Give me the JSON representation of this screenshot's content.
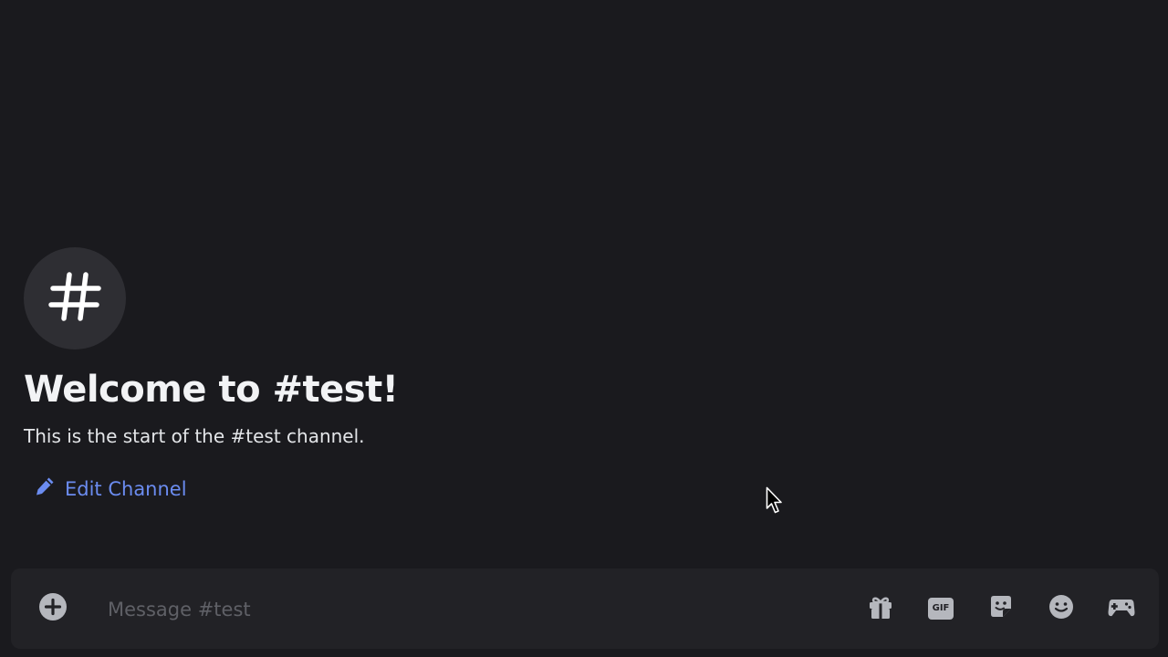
{
  "welcome": {
    "icon": "hash-icon",
    "title": "Welcome to #test!",
    "subtitle": "This is the start of the #test channel.",
    "edit_label": "Edit Channel"
  },
  "composer": {
    "placeholder": "Message #test",
    "value": "",
    "icons": [
      "add-circle-icon",
      "gift-icon",
      "gif-icon",
      "sticker-icon",
      "emoji-icon",
      "activities-icon"
    ],
    "gif_label": "GIF"
  },
  "colors": {
    "background": "#1a1a1e",
    "composer": "#222226",
    "accent": "#6b8cf0"
  }
}
